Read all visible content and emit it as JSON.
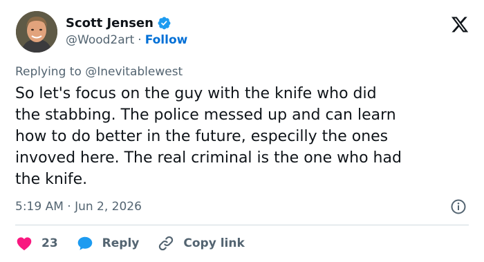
{
  "author": {
    "display_name": "Scott Jensen",
    "handle": "@Wood2art",
    "follow_label": "Follow",
    "separator": "·"
  },
  "reply_context": {
    "label": "Replying to @Inevitablewest"
  },
  "tweet": {
    "text": "So let's focus on the guy with the knife who did\nthe stabbing. The police messed up and can learn\nhow to do better in the future, especilly the ones\ninvoved here. The real criminal is the one who had\nthe knife.",
    "timestamp": "5:19 AM · Jun 2, 2026"
  },
  "actions": {
    "likes": "23",
    "reply_label": "Reply",
    "copy_link_label": "Copy link"
  },
  "icons": {
    "verified": "verified-badge-icon",
    "logo": "x-logo-icon",
    "info": "info-icon",
    "like": "heart-icon",
    "reply": "speech-bubble-icon",
    "copy": "link-icon"
  },
  "colors": {
    "text": "#0f1419",
    "secondary": "#536471",
    "link": "#006fd6",
    "verified": "#1d9bf0",
    "heart": "#f91880",
    "divider": "#cfd9de"
  }
}
